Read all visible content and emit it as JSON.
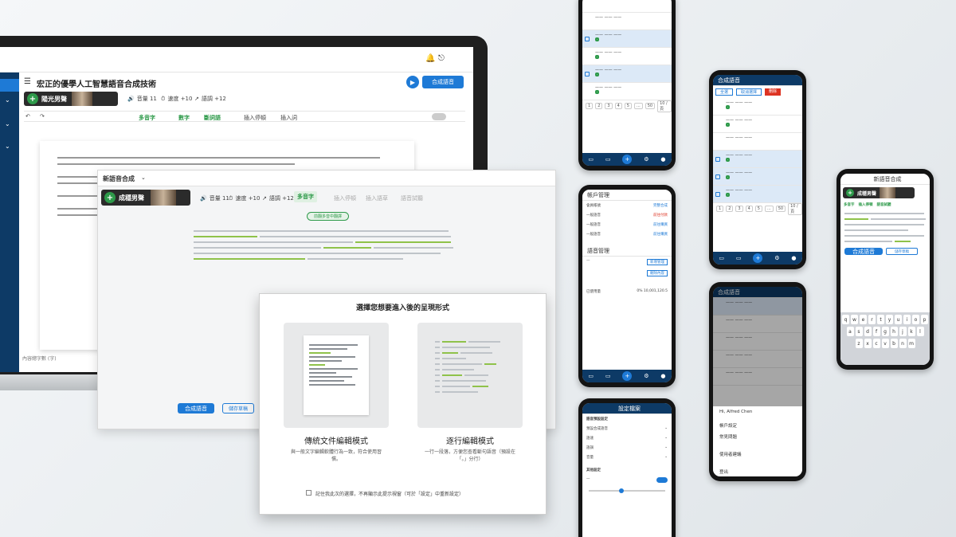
{
  "laptop": {
    "document_title": "宏正的優學人工智慧語音合成技術",
    "voice_name": "陽光男聲",
    "toolbar": {
      "volume": "音量 11",
      "speed": "速度 +10",
      "pitch": "語調 +12"
    },
    "actions": [
      "多音字",
      "數字",
      "斷詞語",
      "插入停頓",
      "插入詞"
    ],
    "compose_button": "合成語音",
    "status_text": "內容總字數 (字)"
  },
  "editor": {
    "window_title": "新語音合成",
    "voice_name": "成穩男聲",
    "toolbar": {
      "volume": "音量 11",
      "speed": "速度 +10",
      "pitch": "語調 +12"
    },
    "actions": [
      "多音字",
      "插入停頓",
      "插入語草",
      "語音試聽"
    ],
    "notice": "前翻多音中翻譯",
    "compose_button": "合成語音",
    "save_button": "儲存草稿"
  },
  "dialog": {
    "title": "選擇您想要進入後的呈現形式",
    "option_traditional": {
      "title": "傳統文件編輯模式",
      "description": "與一般文字編輯軟體行為一致，符合使用習慣。"
    },
    "option_line": {
      "title": "逐行編輯模式",
      "description": "一行一段落，方便您查看斷句語音（預設在「。」分行）"
    },
    "remember_label": "記住我此次的選擇，不再顯示此提示視窗（可於「設定」中重新設定）"
  },
  "phone1": {
    "pages": [
      "1",
      "2",
      "3",
      "4",
      "5",
      "...",
      "50"
    ],
    "per_page": "10 / 頁"
  },
  "phone2": {
    "section": "帳戶管理",
    "rows": [
      [
        "會員帳號",
        "完整合成"
      ],
      [
        "一般語音",
        "前往付款"
      ],
      [
        "一般語音",
        "前往購買"
      ],
      [
        "一般語音",
        "前往購買"
      ]
    ],
    "section2": "語音管理",
    "link1": "新增管理",
    "link2": "刪除內容",
    "usage": "已使用量",
    "usage_value": "0% 10,001,120.5"
  },
  "phone3": {
    "title": "合成語音",
    "tabs": [
      "全選",
      "取消選擇",
      "刪除"
    ],
    "pages": [
      "1",
      "2",
      "3",
      "4",
      "5",
      "...",
      "50"
    ],
    "per_page": "10 / 頁"
  },
  "phone4": {
    "title": "設定檔案",
    "sections": [
      "語音預設設定",
      "其他設定"
    ],
    "rows": [
      "預設合成語音",
      "語速",
      "語調",
      "音量"
    ]
  },
  "phone5": {
    "title": "合成語音",
    "menu_user": "Hi, Alfred Chen",
    "menu_items": [
      "帳戶設定",
      "常見問題",
      "使用者建議",
      "登出"
    ]
  },
  "phone6": {
    "title": "新語音合成",
    "voice_name": "成穩男聲",
    "actions": [
      "多音字",
      "插入停頓",
      "語音試聽"
    ],
    "compose_button": "合成語音",
    "save_button": "儲存草稿",
    "keyboard_rows": [
      "qwertyuiop",
      "asdfghjkl",
      "zxcvbnm"
    ]
  },
  "colors": {
    "primary": "#1e7ad6",
    "navy": "#0d3a66",
    "green": "#2e9a4a",
    "highlight": "#8fc24a"
  }
}
